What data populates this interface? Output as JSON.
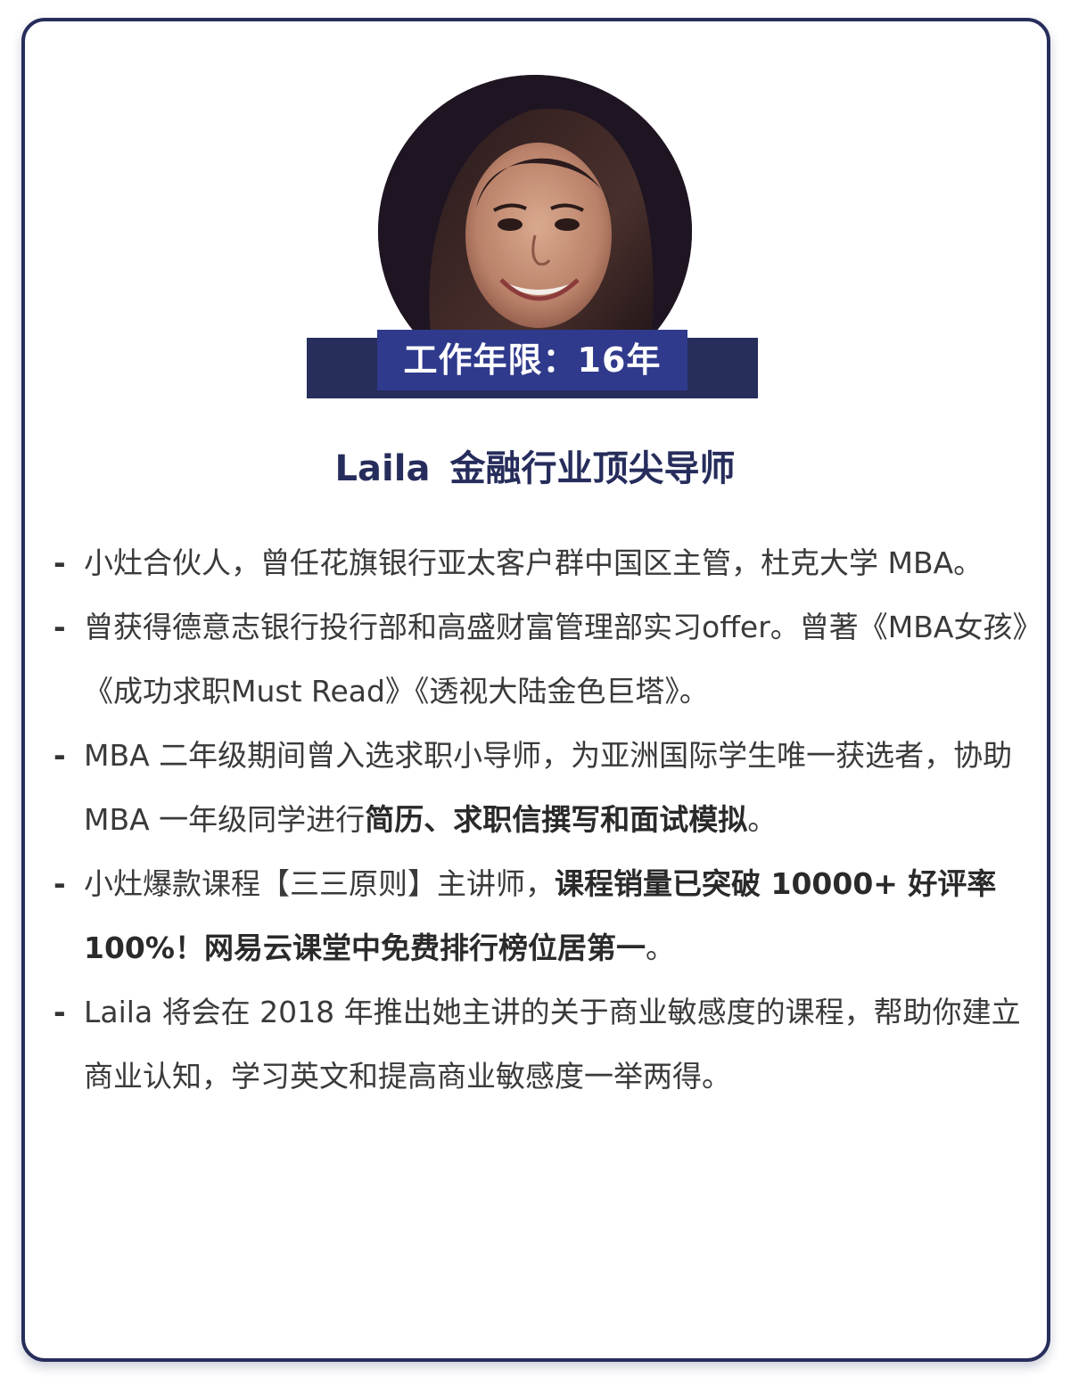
{
  "badge": {
    "text": "工作年限：16年"
  },
  "title": {
    "name": "Laila",
    "role": "金融行业顶尖导师"
  },
  "bullets": [
    {
      "dash": "-",
      "parts": [
        {
          "t": "小灶合伙人，曾任花旗银行亚太客户群中国区主管，杜克大学 MBA。",
          "b": false
        }
      ]
    },
    {
      "dash": "-",
      "parts": [
        {
          "t": "曾获得德意志银行投行部和高盛财富管理部实习offer。曾著《MBA女孩》《成功求职Must Read》《透视大陆金色巨塔》。",
          "b": false
        }
      ]
    },
    {
      "dash": "-",
      "parts": [
        {
          "t": "MBA 二年级期间曾入选求职小导师，为亚洲国际学生唯一获选者，协助 MBA 一年级同学进行",
          "b": false
        },
        {
          "t": "简历、求职信撰写和面试模拟",
          "b": true
        },
        {
          "t": "。",
          "b": false
        }
      ]
    },
    {
      "dash": "-",
      "parts": [
        {
          "t": " 小灶爆款课程【三三原则】主讲师，",
          "b": false
        },
        {
          "t": "课程销量已突破 10000+ 好评率 100%！网易云课堂中免费排行榜位居第一",
          "b": true
        },
        {
          "t": "。",
          "b": false
        }
      ]
    },
    {
      "dash": "-",
      "parts": [
        {
          "t": " Laila 将会在 2018 年推出她主讲的关于商业敏感度的课程，帮助你建立商业认知，学习英文和提高商业敏感度一举两得。",
          "b": false
        }
      ]
    }
  ],
  "colors": {
    "navy": "#272e5c",
    "badge_blue": "#2f3a8c",
    "text": "#3a3a3a"
  }
}
